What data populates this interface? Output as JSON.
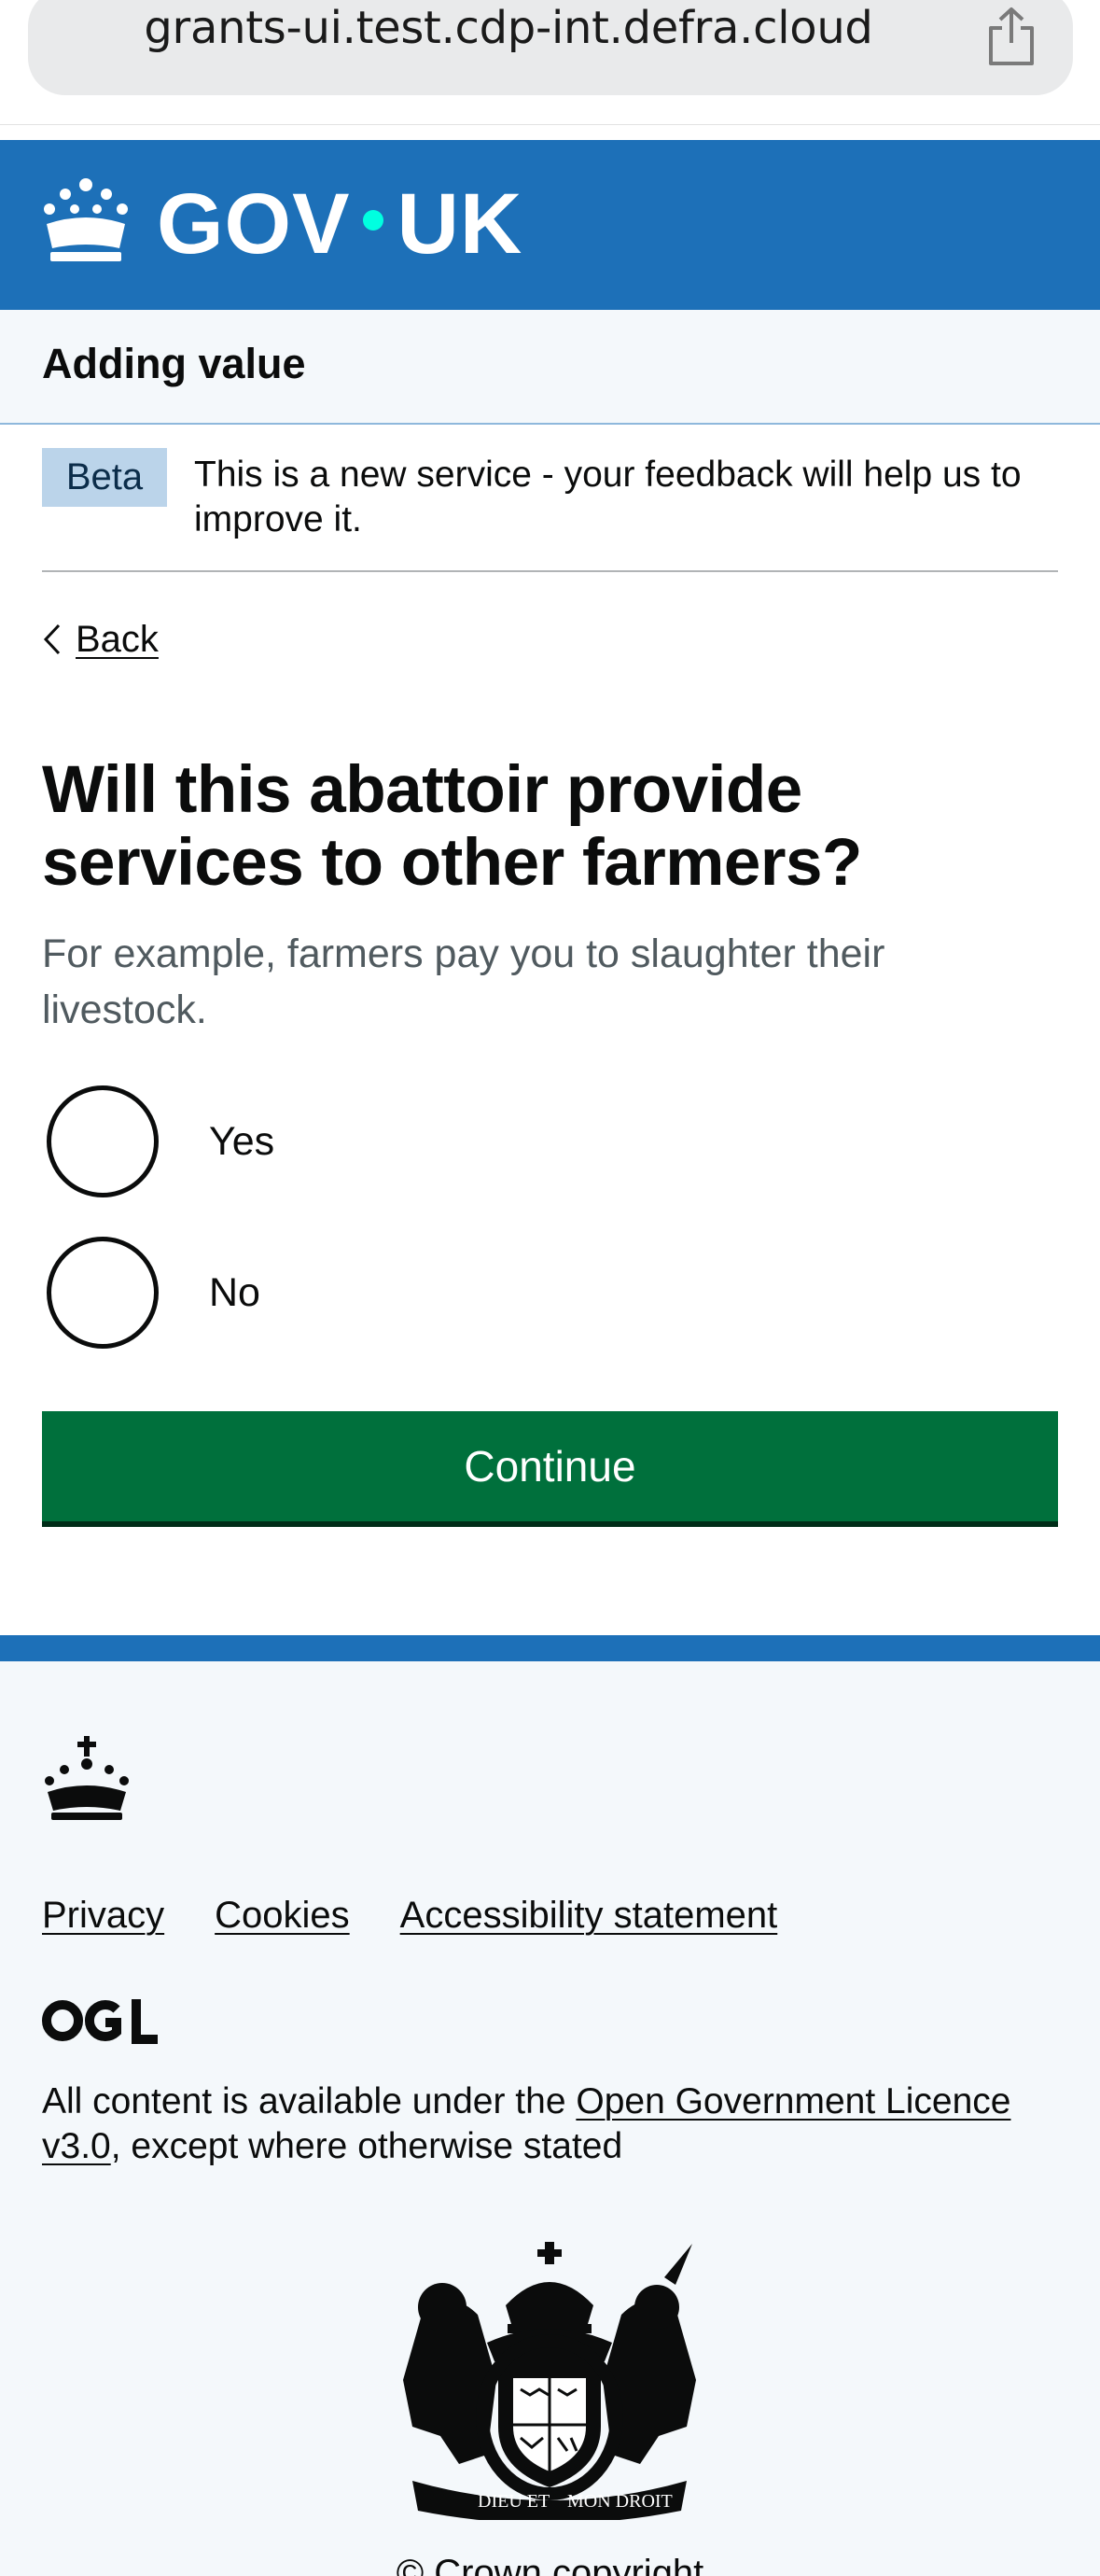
{
  "browser": {
    "url": "grants-ui.test.cdp-int.defra.cloud"
  },
  "header": {
    "wordmark_left": "GOV",
    "wordmark_right": "UK"
  },
  "service_nav": {
    "service_name": "Adding value"
  },
  "phase_banner": {
    "tag": "Beta",
    "text": "This is a new service - your feedback will help us to improve it."
  },
  "back_link": {
    "label": "Back"
  },
  "question": {
    "heading": "Will this abattoir provide services to other farmers?",
    "hint": "For example, farmers pay you to slaughter their livestock.",
    "options": [
      {
        "label": "Yes",
        "selected": false
      },
      {
        "label": "No",
        "selected": false
      }
    ]
  },
  "actions": {
    "continue_label": "Continue"
  },
  "footer": {
    "links": [
      "Privacy",
      "Cookies",
      "Accessibility statement"
    ],
    "licence_prefix": "All content is available under the ",
    "licence_link": "Open Government Licence v3.0",
    "licence_suffix": ", except where otherwise stated",
    "arms_motto_left": "DIEU ET",
    "arms_motto_right": "MON DROIT",
    "copyright": "© Crown copyright"
  },
  "colors": {
    "header_blue": "#1d70b8",
    "button_green": "#00703c",
    "wordmark_dot": "#00ffe0",
    "footer_bg": "#f4f8fb"
  }
}
